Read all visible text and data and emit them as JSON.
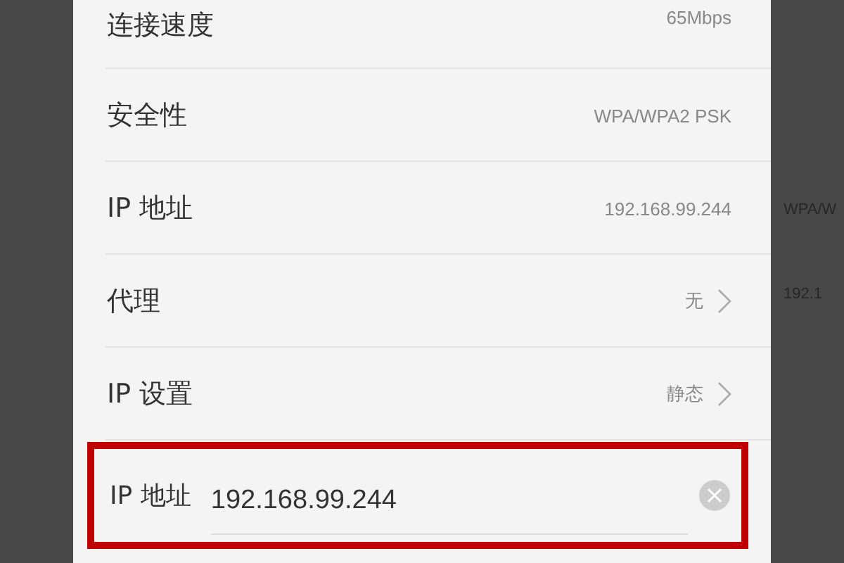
{
  "details": [
    {
      "label": "连接速度",
      "value": "65Mbps",
      "kind": "info"
    },
    {
      "label": "安全性",
      "value": "WPA/WPA2 PSK",
      "kind": "info"
    },
    {
      "label": "IP 地址",
      "value": "192.168.99.244",
      "kind": "info"
    },
    {
      "label": "代理",
      "value": "无",
      "kind": "link"
    },
    {
      "label": "IP 设置",
      "value": "静态",
      "kind": "link"
    }
  ],
  "ip_field": {
    "label": "IP 地址",
    "value": "192.168.99.244",
    "highlighted": true
  },
  "background_texts": [
    "WPA/W",
    "192.1"
  ]
}
